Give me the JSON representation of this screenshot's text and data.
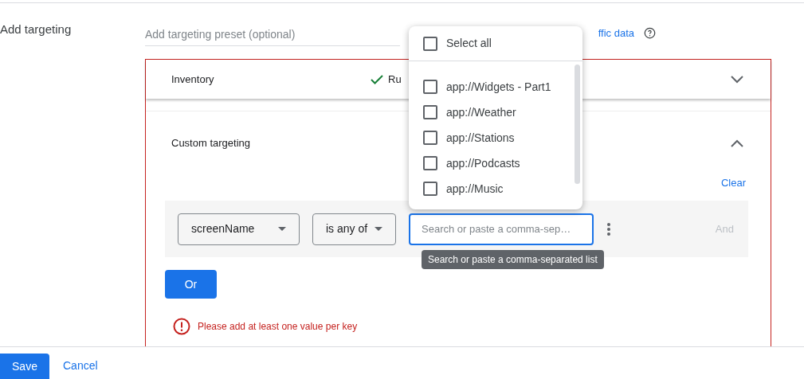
{
  "section_label": "Add targeting",
  "preset_field": {
    "placeholder": "Add targeting preset (optional)"
  },
  "traffic_link": "ffic data",
  "inventory": {
    "title": "Inventory",
    "status": "Ru",
    "expanded": false
  },
  "custom_targeting": {
    "title": "Custom targeting",
    "expanded": true,
    "clear": "Clear",
    "key_select": "screenName",
    "operator_select": "is any of",
    "value_field": {
      "placeholder": "Search or paste a comma-sep…",
      "focused": true
    },
    "and": "And",
    "or": "Or",
    "error": "Please add at least one value per key"
  },
  "tooltip": "Search or paste a comma-separated list",
  "dropdown": {
    "select_all": {
      "label": "Select all",
      "checked": false
    },
    "options": [
      {
        "label": "app://Widgets - Part1",
        "checked": false
      },
      {
        "label": "app://Weather",
        "checked": false
      },
      {
        "label": "app://Stations",
        "checked": false
      },
      {
        "label": "app://Podcasts",
        "checked": false
      },
      {
        "label": "app://Music",
        "checked": false
      }
    ]
  },
  "footer": {
    "save": "Save",
    "cancel": "Cancel"
  }
}
